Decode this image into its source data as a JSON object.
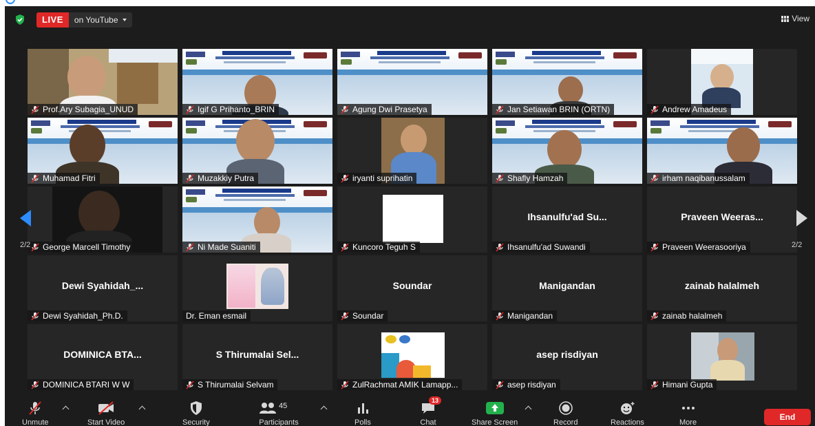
{
  "topbar": {
    "live_label": "LIVE",
    "stream_label": "on YouTube",
    "view_label": "View"
  },
  "pagination": {
    "left": "2/2",
    "right": "2/2"
  },
  "tiles": [
    {
      "name": "Prof.Ary Subagia_UNUD",
      "center": "",
      "muted": true
    },
    {
      "name": "Igif G Prihanto_BRIN",
      "center": "",
      "muted": true
    },
    {
      "name": "Agung Dwi Prasetya",
      "center": "",
      "muted": true
    },
    {
      "name": "Jan Setiawan BRIN (ORTN)",
      "center": "",
      "muted": true
    },
    {
      "name": "Andrew Amadeus",
      "center": "",
      "muted": true
    },
    {
      "name": "Muhamad Fitri",
      "center": "",
      "muted": true
    },
    {
      "name": "Muzakkiy Putra",
      "center": "",
      "muted": true
    },
    {
      "name": "iryanti suprihatin",
      "center": "",
      "muted": true
    },
    {
      "name": "Shafly Hamzah",
      "center": "",
      "muted": true
    },
    {
      "name": "irham naqibanussalam",
      "center": "",
      "muted": true
    },
    {
      "name": "George Marcell Timothy",
      "center": "",
      "muted": true
    },
    {
      "name": "Ni Made Suaniti",
      "center": "",
      "muted": true
    },
    {
      "name": "Kuncoro Teguh S",
      "center": "",
      "muted": true
    },
    {
      "name": "Ihsanulfu'ad Suwandi",
      "center": "Ihsanulfu'ad  Su...",
      "muted": true
    },
    {
      "name": "Praveen Weerasooriya",
      "center": "Praveen  Weeras...",
      "muted": true
    },
    {
      "name": "Dewi Syahidah_Ph.D.",
      "center": "Dewi  Syahidah_...",
      "muted": true
    },
    {
      "name": "Dr. Eman esmail",
      "center": "",
      "muted": false
    },
    {
      "name": "Soundar",
      "center": "Soundar",
      "muted": true
    },
    {
      "name": "Manigandan",
      "center": "Manigandan",
      "muted": true
    },
    {
      "name": "zainab halalmeh",
      "center": "zainab halalmeh",
      "muted": true
    },
    {
      "name": "DOMINICA BTARI W W",
      "center": "DOMINICA  BTA...",
      "muted": true
    },
    {
      "name": "S Thirumalai Selvam",
      "center": "S  Thirumalai  Sel...",
      "muted": true
    },
    {
      "name": "ZulRachmat AMIK Lamapp...",
      "center": "",
      "muted": true
    },
    {
      "name": "asep risdiyan",
      "center": "asep risdiyan",
      "muted": true
    },
    {
      "name": "Himani Gupta",
      "center": "",
      "muted": true
    }
  ],
  "toolbar": {
    "unmute": "Unmute",
    "start_video": "Start Video",
    "security": "Security",
    "participants": "Participants",
    "participants_count": "45",
    "polls": "Polls",
    "chat": "Chat",
    "chat_badge": "13",
    "share_screen": "Share Screen",
    "record": "Record",
    "reactions": "Reactions",
    "more": "More",
    "end": "End"
  },
  "colors": {
    "background": "#1c1c1c",
    "tile": "#262626",
    "live_red": "#e02828",
    "share_green": "#23b14d",
    "accent_blue": "#2d8cff"
  }
}
